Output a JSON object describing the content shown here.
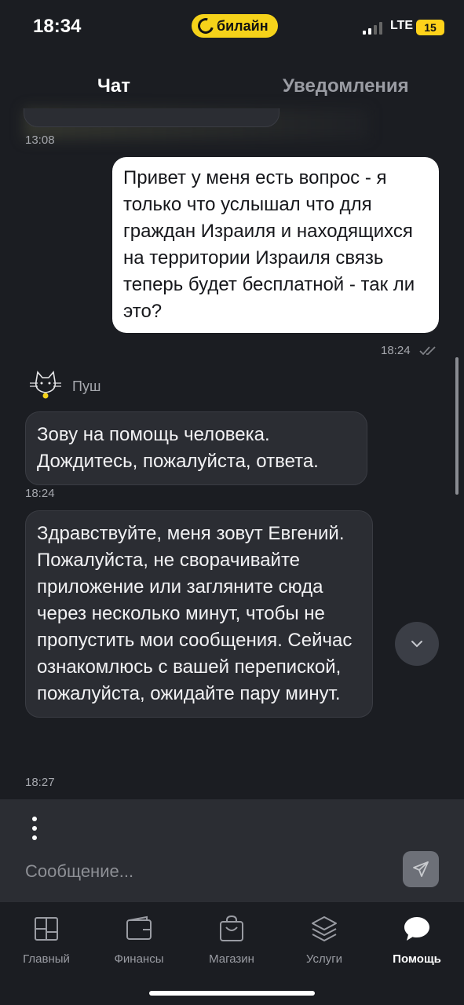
{
  "status_bar": {
    "time": "18:34",
    "carrier": "билайн",
    "network": "LTE",
    "battery": "15"
  },
  "header": {
    "tabs": [
      {
        "label": "Чат"
      },
      {
        "label": "Уведомления"
      }
    ]
  },
  "chat": {
    "earlier_time": "13:08",
    "outgoing": {
      "text": "Привет у меня есть вопрос - я только что услышал что для граждан Израиля и находящихся на территории Израиля связь теперь будет бесплатной - так ли это?",
      "time": "18:24"
    },
    "sender": {
      "name": "Пуш"
    },
    "incoming": [
      {
        "text": "Зову на помощь человека. Дождитесь, пожалуйста, ответа.",
        "time": "18:24"
      },
      {
        "text": "Здравствуйте, меня зовут Евгений. Пожалуйста, не сворачивайте приложение или загляните сюда через несколько минут, чтобы не пропустить мои сообщения. Сейчас ознакомлюсь с вашей перепиской, пожалуйста, ожидайте пару минут.",
        "time": "18:27"
      }
    ]
  },
  "composer": {
    "placeholder": "Сообщение..."
  },
  "bottom_nav": {
    "items": [
      {
        "label": "Главный",
        "icon": "grid-icon"
      },
      {
        "label": "Финансы",
        "icon": "wallet-icon"
      },
      {
        "label": "Магазин",
        "icon": "shopping-bag-icon"
      },
      {
        "label": "Услуги",
        "icon": "layers-icon"
      },
      {
        "label": "Помощь",
        "icon": "chat-bubble-icon"
      }
    ],
    "active_index": 4
  },
  "colors": {
    "background": "#1b1d22",
    "incoming_bubble": "#2b2d33",
    "outgoing_bubble": "#ffffff",
    "brand_yellow": "#f5d21a"
  }
}
